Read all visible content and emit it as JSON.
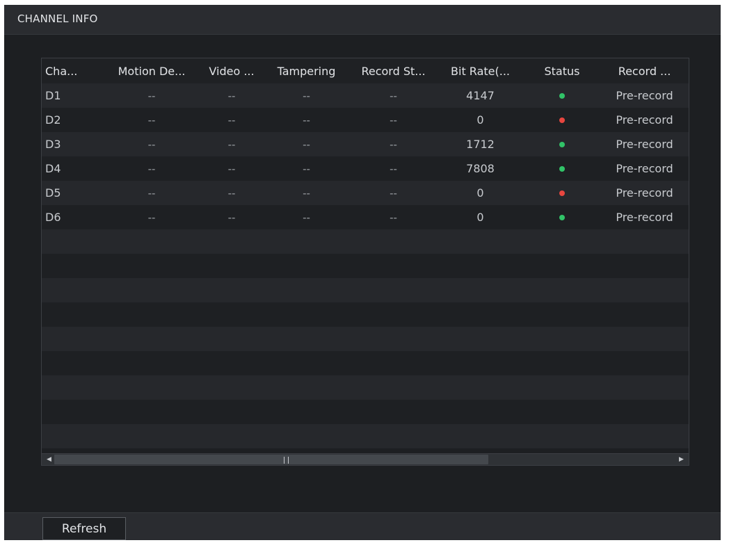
{
  "window": {
    "title": "CHANNEL INFO"
  },
  "table": {
    "columns": [
      "Cha...",
      "Motion De...",
      "Video ...",
      "Tampering",
      "Record St...",
      "Bit Rate(...",
      "Status",
      "Record ..."
    ],
    "rows": [
      {
        "channel": "D1",
        "motion": "--",
        "video": "--",
        "tampering": "--",
        "record_status": "--",
        "bit_rate": "4147",
        "status": "online",
        "record_mode": "Pre-record"
      },
      {
        "channel": "D2",
        "motion": "--",
        "video": "--",
        "tampering": "--",
        "record_status": "--",
        "bit_rate": "0",
        "status": "offline",
        "record_mode": "Pre-record"
      },
      {
        "channel": "D3",
        "motion": "--",
        "video": "--",
        "tampering": "--",
        "record_status": "--",
        "bit_rate": "1712",
        "status": "online",
        "record_mode": "Pre-record"
      },
      {
        "channel": "D4",
        "motion": "--",
        "video": "--",
        "tampering": "--",
        "record_status": "--",
        "bit_rate": "7808",
        "status": "online",
        "record_mode": "Pre-record"
      },
      {
        "channel": "D5",
        "motion": "--",
        "video": "--",
        "tampering": "--",
        "record_status": "--",
        "bit_rate": "0",
        "status": "offline",
        "record_mode": "Pre-record"
      },
      {
        "channel": "D6",
        "motion": "--",
        "video": "--",
        "tampering": "--",
        "record_status": "--",
        "bit_rate": "0",
        "status": "online",
        "record_mode": "Pre-record"
      }
    ]
  },
  "colors": {
    "status_online": "#31c368",
    "status_offline": "#e8463f"
  },
  "icons": {
    "scroll_left": "triangle-left-icon",
    "scroll_right": "triangle-right-icon",
    "scroll_grip": "grip-icon"
  },
  "footer": {
    "refresh_label": "Refresh"
  }
}
